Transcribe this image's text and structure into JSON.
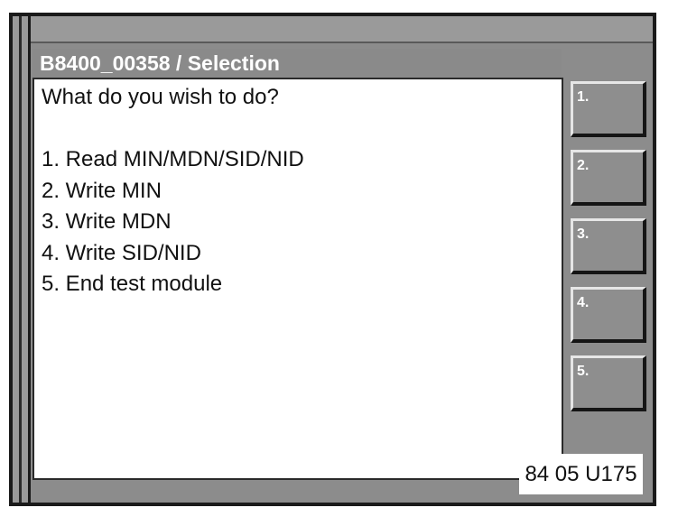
{
  "window": {
    "title": "B8400_00358 / Selection"
  },
  "content": {
    "question": "What do you wish to do?",
    "options": [
      "1. Read MIN/MDN/SID/NID",
      "2. Write MIN",
      "3. Write MDN",
      "4. Write SID/NID",
      "5. End test module"
    ]
  },
  "side_buttons": [
    {
      "label": "1."
    },
    {
      "label": "2."
    },
    {
      "label": "3."
    },
    {
      "label": "4."
    },
    {
      "label": "5."
    }
  ],
  "figure_code": "84 05 U175",
  "colors": {
    "frame_gray": "#8c8c8c",
    "title_text": "#ffffff",
    "content_bg": "#ffffff",
    "border_dark": "#1a1a1a"
  }
}
